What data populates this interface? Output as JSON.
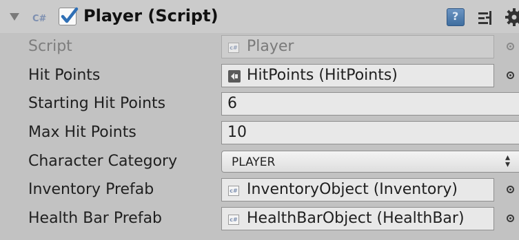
{
  "component": {
    "title": "Player (Script)",
    "badge": "C#",
    "enabled": true,
    "icons": [
      "fold-arrow-icon",
      "csharp-script-icon",
      "checkbox-icon",
      "help-icon",
      "preset-icon",
      "gear-icon"
    ]
  },
  "fields": {
    "script": {
      "label": "Script",
      "value": "Player",
      "icon": "csharp-file-icon"
    },
    "hit_points": {
      "label": "Hit Points",
      "value": "HitPoints (HitPoints)",
      "icon": "scriptable-object-icon"
    },
    "starting_hit_points": {
      "label": "Starting Hit Points",
      "value": "6"
    },
    "max_hit_points": {
      "label": "Max Hit Points",
      "value": "10"
    },
    "character_category": {
      "label": "Character Category",
      "value": "PLAYER"
    },
    "inventory_prefab": {
      "label": "Inventory Prefab",
      "value": "InventoryObject (Inventory)",
      "icon": "csharp-file-icon"
    },
    "health_bar_prefab": {
      "label": "Health Bar Prefab",
      "value": "HealthBarObject (HealthBar)",
      "icon": "csharp-file-icon"
    }
  },
  "colors": {
    "background": "#c2c2c2",
    "header": "#cbcbcb",
    "field": "#e8e8e8",
    "check": "#2f6fb5",
    "help": "#4f7fb2"
  }
}
